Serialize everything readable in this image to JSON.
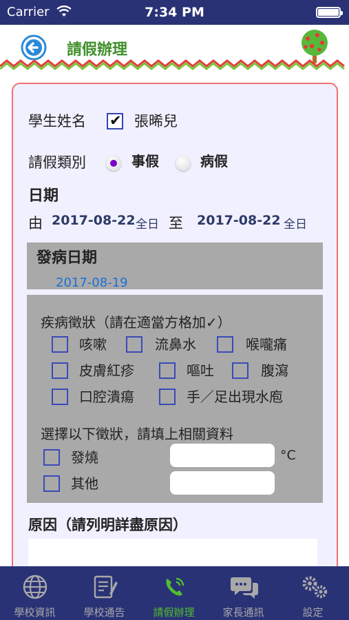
{
  "status_bar": {
    "carrier": "Carrier",
    "time": "7:34 PM"
  },
  "nav": {
    "title": "請假辦理"
  },
  "form": {
    "student_label": "學生姓名",
    "student_name": "張晞兒",
    "student_checked": true,
    "leave_type_label": "請假類別",
    "leave_types": [
      {
        "label": "事假",
        "selected": true
      },
      {
        "label": "病假",
        "selected": false
      }
    ],
    "date_label": "日期",
    "from_label": "由",
    "from_date": "2017-08-22",
    "from_period": "全日",
    "to_label": "至",
    "to_date": "2017-08-22",
    "to_period": "全日"
  },
  "onset": {
    "label": "發病日期",
    "date": "2017-08-19"
  },
  "symptoms": {
    "title": "疾病徵狀（請在適當方格加✓）",
    "items": [
      "咳嗽",
      "流鼻水",
      "喉嚨痛",
      "皮膚紅疹",
      "嘔吐",
      "腹瀉",
      "口腔潰瘍",
      "手／足出現水庖"
    ],
    "extra_title": "選擇以下徵狀，請填上相關資料",
    "fever_label": "發燒",
    "fever_unit": "°C",
    "fever_value": "",
    "other_label": "其他",
    "other_value": ""
  },
  "reason": {
    "label": "原因（請列明詳盡原因）",
    "value": ""
  },
  "tabs": [
    {
      "label": "學校資訊",
      "icon": "globe-icon",
      "active": false
    },
    {
      "label": "學校通告",
      "icon": "notice-icon",
      "active": false
    },
    {
      "label": "請假辦理",
      "icon": "phone-icon",
      "active": true
    },
    {
      "label": "家長通訊",
      "icon": "chat-icon",
      "active": false
    },
    {
      "label": "設定",
      "icon": "gear-icon",
      "active": false
    }
  ],
  "colors": {
    "header": "#2a3276",
    "title_green": "#3f8f2a",
    "active_tab": "#4fbf2e",
    "card_border": "#f07070",
    "onset_date": "#1a6fd8"
  }
}
